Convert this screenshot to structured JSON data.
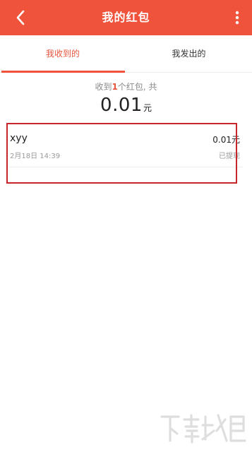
{
  "header": {
    "title": "我的红包",
    "back_icon": "back-arrow-icon",
    "more_icon": "more-vertical-icon",
    "color": "#f0533c"
  },
  "tabs": [
    {
      "label": "我收到的",
      "active": true
    },
    {
      "label": "我发出的",
      "active": false
    }
  ],
  "summary": {
    "prefix": "收到",
    "count": "1",
    "suffix": "个红包, 共",
    "total_amount": "0.01",
    "unit": "元"
  },
  "records": [
    {
      "name": "xyy",
      "time": "2月18日 14:39",
      "amount": "0.01元",
      "status": "已提现"
    }
  ],
  "annotation": {
    "highlight_color": "#c8242b"
  },
  "watermark": {
    "logo": "xiazaiba-logo"
  },
  "accent_color": "#e8553e"
}
